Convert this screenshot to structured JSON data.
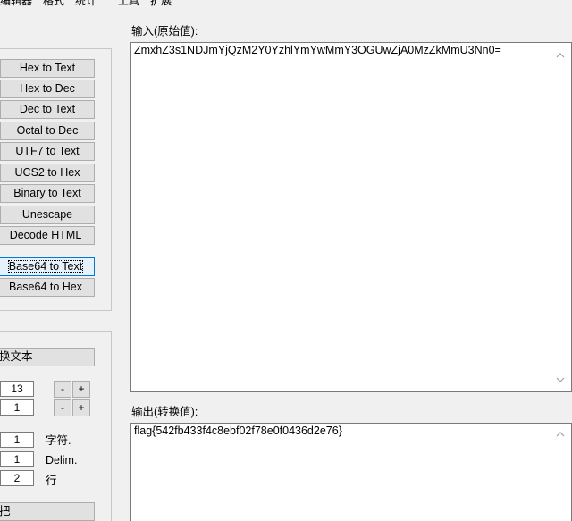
{
  "menu": {
    "items": [
      "编辑器",
      "格式",
      "统计",
      "工具",
      "扩展"
    ]
  },
  "decode_buttons": [
    "Hex to Text",
    "Hex to Dec",
    "Dec to Text",
    "Octal to Dec",
    "UTF7 to Text",
    "UCS2 to Hex",
    "Binary to Text",
    "Unescape",
    "Decode HTML",
    "Base64 to Text",
    "Base64 to Hex"
  ],
  "replace": {
    "button_label": "换文本",
    "row1": {
      "value": "13",
      "minus": "-",
      "plus": "+"
    },
    "row2": {
      "value": "1",
      "minus": "-",
      "plus": "+"
    },
    "char_value": "1",
    "char_label": "字符.",
    "delim_value": "1",
    "delim_label": "Delim.",
    "line_value": "2",
    "line_label": "行",
    "bottom_button_label": "把"
  },
  "input": {
    "label": "输入(原始值):",
    "value": "ZmxhZ3s1NDJmYjQzM2Y0YzhlYmYwMmY3OGUwZjA0MzZkMmU3Nn0="
  },
  "output": {
    "label": "输出(转换值):",
    "value": "flag{542fb433f4c8ebf02f78e0f0436d2e76}"
  },
  "icons": {
    "scroll_up": "chevron-up-icon",
    "scroll_down": "chevron-down-icon"
  }
}
